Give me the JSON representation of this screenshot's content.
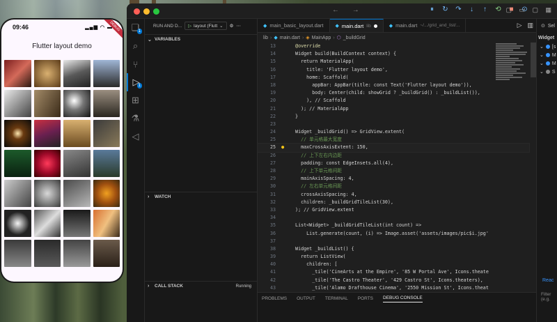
{
  "phone": {
    "time": "09:46",
    "signal": "▂▄▆ ◠ ▬",
    "debug_banner": "DEBUG",
    "appbar_title": "Flutter layout demo"
  },
  "titlebar": {
    "nav": "← →",
    "layout_icons": "▢ ▭ ▢ ▦"
  },
  "debug_toolbar": [
    "⏸",
    "↻",
    "↷",
    "↓",
    "↑",
    "⟲",
    "■",
    "⊙"
  ],
  "debug_side": {
    "title": "RUN AND D...",
    "config": "layout (Flutt",
    "variables": "VARIABLES",
    "watch": "WATCH",
    "call_stack": "CALL STACK",
    "call_stack_status": "Running"
  },
  "tabs": [
    {
      "label": "main_basic_layout.dart",
      "active": false,
      "modified": false,
      "dim": ""
    },
    {
      "label": "main.dart",
      "active": true,
      "modified": true,
      "dim": "lib"
    },
    {
      "label": "main.dart",
      "active": false,
      "modified": false,
      "dim": "~/.../grid_and_list/..."
    }
  ],
  "breadcrumb": [
    "lib",
    "main.dart",
    "MainApp",
    "_buildGrid"
  ],
  "code": [
    {
      "n": "13",
      "t": "  @override"
    },
    {
      "n": "14",
      "t": "  Widget build(BuildContext context) {"
    },
    {
      "n": "15",
      "t": "    return MaterialApp("
    },
    {
      "n": "16",
      "t": "      title: 'Flutter layout demo',"
    },
    {
      "n": "17",
      "t": "      home: Scaffold("
    },
    {
      "n": "18",
      "t": "        appBar: AppBar(title: const Text('Flutter layout demo')),"
    },
    {
      "n": "19",
      "t": "        body: Center(child: showGrid ? _buildGrid() : _buildList()),"
    },
    {
      "n": "20",
      "t": "      ), // Scaffold"
    },
    {
      "n": "21",
      "t": "    ); // MaterialApp"
    },
    {
      "n": "22",
      "t": "  }"
    },
    {
      "n": "23",
      "t": ""
    },
    {
      "n": "24",
      "t": "  Widget _buildGrid() => GridView.extent("
    },
    {
      "n": "25",
      "t": "    // 单元格最大宽度"
    },
    {
      "n": "25",
      "t": "    maxCrossAxisExtent: 150,"
    },
    {
      "n": "26",
      "t": "    // 上下左右内边距"
    },
    {
      "n": "27",
      "t": "    padding: const EdgeInsets.all(4),"
    },
    {
      "n": "28",
      "t": "    // 上下单元格间距"
    },
    {
      "n": "29",
      "t": "    mainAxisSpacing: 4,"
    },
    {
      "n": "30",
      "t": "    // 左右单元格间距"
    },
    {
      "n": "31",
      "t": "    crossAxisSpacing: 4,"
    },
    {
      "n": "32",
      "t": "    children: _buildGridTileList(30),"
    },
    {
      "n": "33",
      "t": "  ); // GridView.extent"
    },
    {
      "n": "34",
      "t": ""
    },
    {
      "n": "35",
      "t": "  List<Widget> _buildGridTileList(int count) =>"
    },
    {
      "n": "36",
      "t": "      List.generate(count, (i) => Image.asset('assets/images/pic$i.jpg'"
    },
    {
      "n": "37",
      "t": ""
    },
    {
      "n": "38",
      "t": "  Widget _buildList() {"
    },
    {
      "n": "39",
      "t": "    return ListView("
    },
    {
      "n": "40",
      "t": "      children: ["
    },
    {
      "n": "41",
      "t": "        _tile('CineArts at the Empire', '85 W Portal Ave', Icons.theate"
    },
    {
      "n": "42",
      "t": "        _tile('The Castro Theater', '429 Castro St', Icons.theaters),"
    },
    {
      "n": "43",
      "t": "        _tile('Alamo Drafthouse Cinema', '2550 Mission St', Icons.theat"
    }
  ],
  "panel_tabs": [
    "PROBLEMS",
    "OUTPUT",
    "TERMINAL",
    "PORTS",
    "DEBUG CONSOLE"
  ],
  "right_side": {
    "head": "Sel",
    "sub": "Widget",
    "rows": [
      "[s",
      "M",
      "M",
      "S"
    ],
    "link": "Reac",
    "filter": "Filter (e.g."
  }
}
